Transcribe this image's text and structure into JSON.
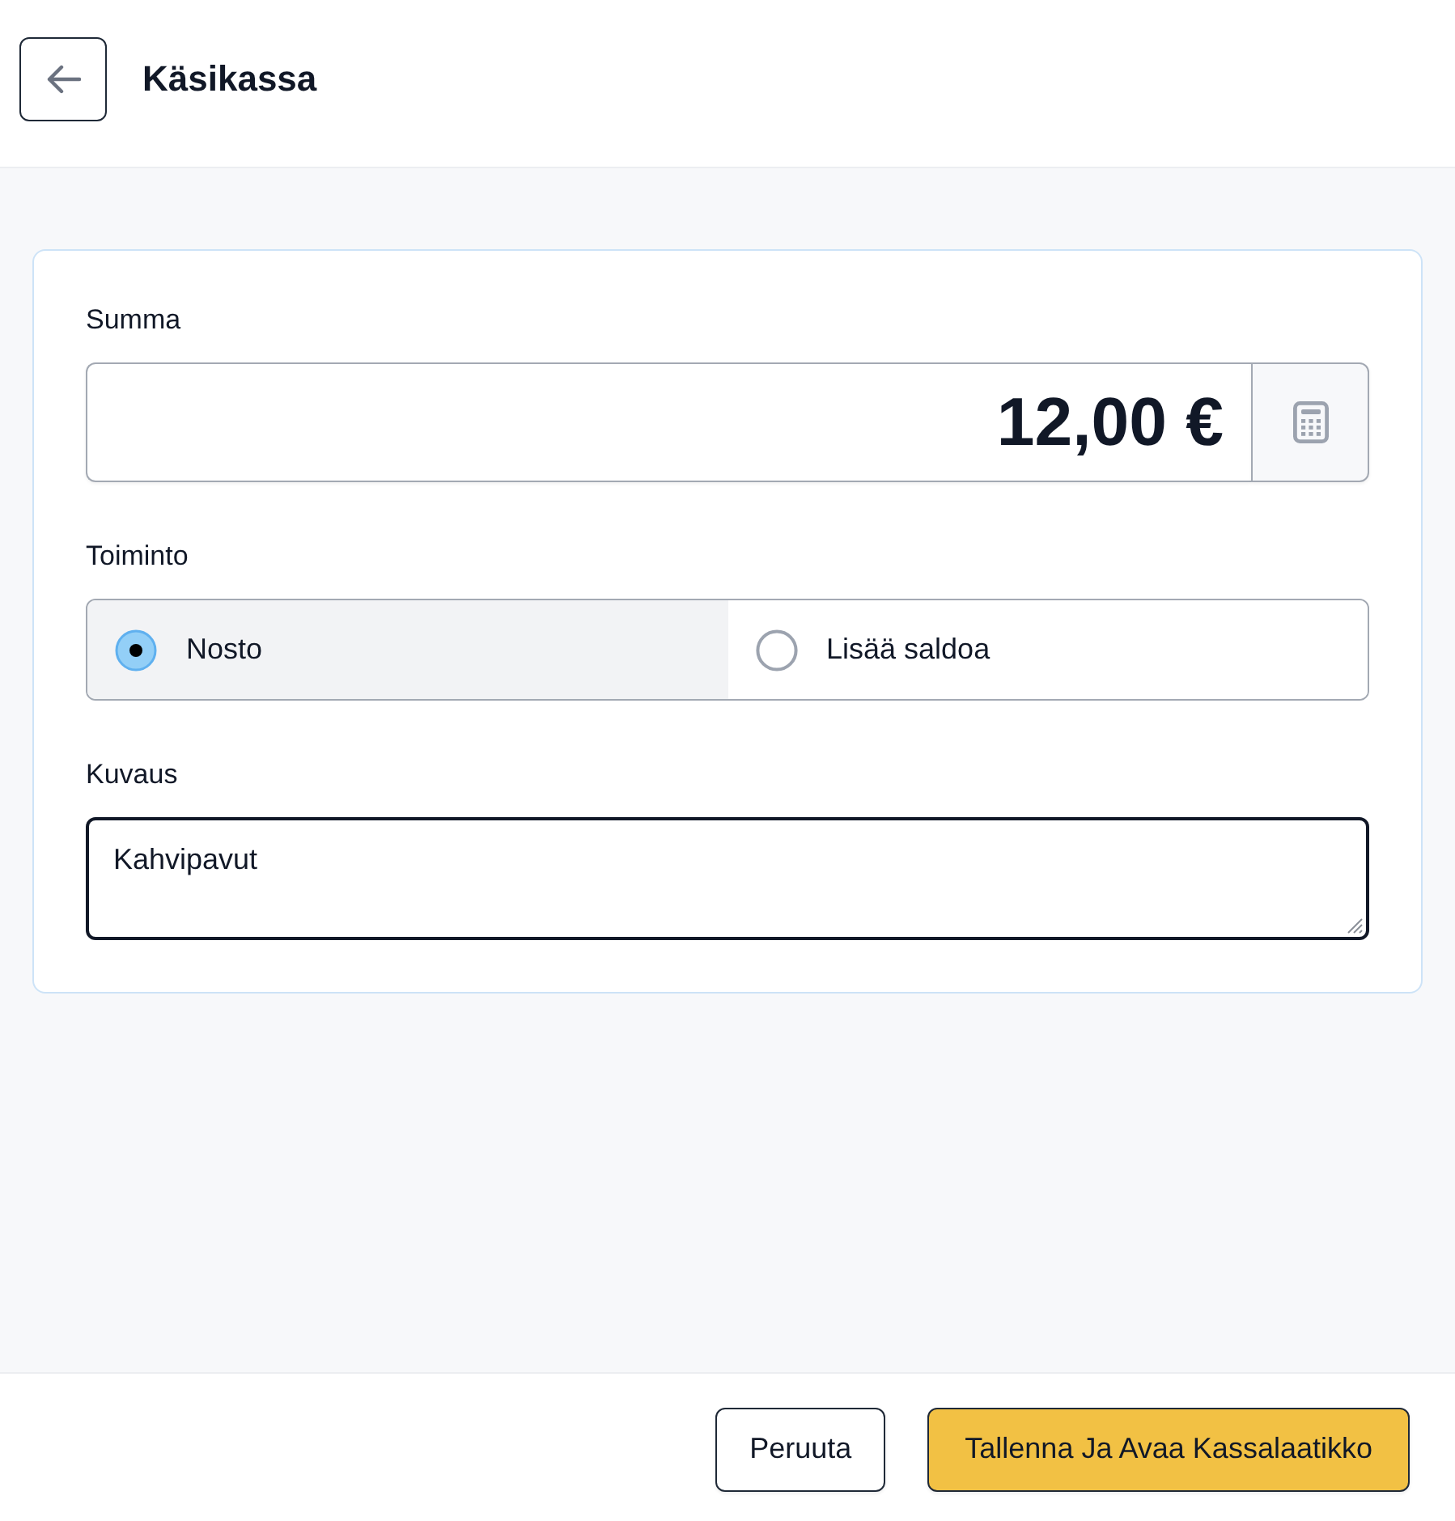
{
  "header": {
    "title": "Käsikassa"
  },
  "form": {
    "amount": {
      "label": "Summa",
      "value": "12,00 €"
    },
    "action": {
      "label": "Toiminto",
      "options": [
        {
          "label": "Nosto",
          "selected": true
        },
        {
          "label": "Lisää saldoa",
          "selected": false
        }
      ]
    },
    "description": {
      "label": "Kuvaus",
      "value": "Kahvipavut",
      "focused": true
    }
  },
  "footer": {
    "buttons": [
      {
        "label": "Peruuta",
        "kind": "secondary"
      },
      {
        "label": "Tallenna Ja Avaa Kassalaatikko",
        "kind": "primary"
      }
    ]
  }
}
